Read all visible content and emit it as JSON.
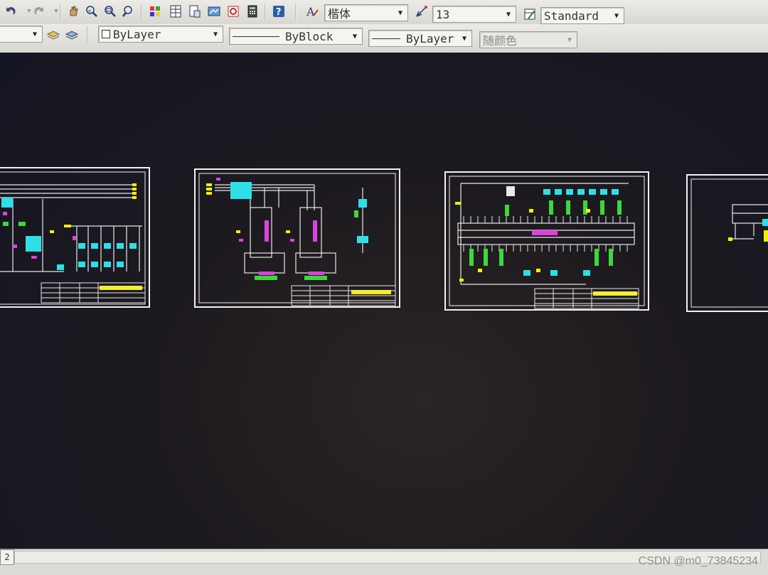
{
  "toolbar1": {
    "buttons": [
      "undo-icon",
      "redo-icon",
      "pan-icon",
      "zoom-realtime-icon",
      "zoom-window-icon",
      "zoom-previous-icon",
      "properties-icon",
      "design-center-icon",
      "tool-palettes-icon",
      "markup-icon",
      "dbconnect-icon",
      "calculator-icon",
      "help-icon"
    ],
    "text_style_icon": "text-style-icon",
    "font_combo": "楷体",
    "dim_style_icon": "dim-style-icon",
    "size_combo": "13",
    "table_style_icon": "table-style-icon",
    "style_combo": "Standard"
  },
  "toolbar2": {
    "layer_icons": [
      "layer-state-icon",
      "layer-previous-icon"
    ],
    "color_combo": "ByLayer",
    "linetype_combo": "ByBlock",
    "lineweight_combo": "ByLayer",
    "plotstyle_combo": "随颜色"
  },
  "status": {
    "layout_tab": "2",
    "watermark": "CSDN @m0_73845234"
  },
  "colors": {
    "canvas": "#16172a",
    "frame": "#f2f2f2",
    "cyan": "#2de0e8",
    "yellow": "#f4f000",
    "magenta": "#e040e0",
    "green": "#3cd83c"
  }
}
